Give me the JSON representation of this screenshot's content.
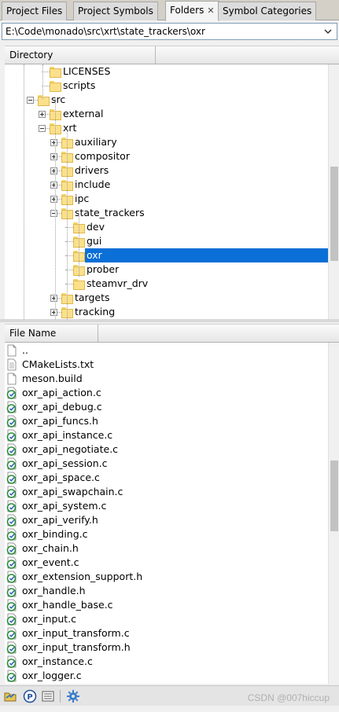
{
  "tabs": [
    {
      "label": "Project Files",
      "active": false
    },
    {
      "label": "Project Symbols",
      "active": false
    },
    {
      "label": "Folders",
      "active": true
    },
    {
      "label": "Symbol Categories",
      "active": false
    }
  ],
  "path": {
    "value": "E:\\Code\\monado\\src\\xrt\\state_trackers\\oxr"
  },
  "directory": {
    "header": "Directory",
    "items": [
      {
        "label": "LICENSES",
        "level": 3,
        "expander": "none"
      },
      {
        "label": "scripts",
        "level": 3,
        "expander": "none"
      },
      {
        "label": "src",
        "level": 2,
        "expander": "minus",
        "no_folder_expander": true
      },
      {
        "label": "external",
        "level": 3,
        "expander": "plus"
      },
      {
        "label": "xrt",
        "level": 3,
        "expander": "minus"
      },
      {
        "label": "auxiliary",
        "level": 4,
        "expander": "plus"
      },
      {
        "label": "compositor",
        "level": 4,
        "expander": "plus"
      },
      {
        "label": "drivers",
        "level": 4,
        "expander": "plus"
      },
      {
        "label": "include",
        "level": 4,
        "expander": "plus"
      },
      {
        "label": "ipc",
        "level": 4,
        "expander": "plus"
      },
      {
        "label": "state_trackers",
        "level": 4,
        "expander": "minus"
      },
      {
        "label": "dev",
        "level": 5,
        "expander": "none"
      },
      {
        "label": "gui",
        "level": 5,
        "expander": "none"
      },
      {
        "label": "oxr",
        "level": 5,
        "expander": "none",
        "selected": true
      },
      {
        "label": "prober",
        "level": 5,
        "expander": "none"
      },
      {
        "label": "steamvr_drv",
        "level": 5,
        "expander": "none"
      },
      {
        "label": "targets",
        "level": 4,
        "expander": "plus"
      },
      {
        "label": "tracking",
        "level": 4,
        "expander": "plus"
      }
    ],
    "scroll_position": 0.55
  },
  "files": {
    "header": "File Name",
    "items": [
      {
        "name": "..",
        "icon": "blank-file-icon"
      },
      {
        "name": "CMakeLists.txt",
        "icon": "text-file-icon"
      },
      {
        "name": "meson.build",
        "icon": "blank-file-icon"
      },
      {
        "name": "oxr_api_action.c",
        "icon": "c-source-icon"
      },
      {
        "name": "oxr_api_debug.c",
        "icon": "c-source-icon"
      },
      {
        "name": "oxr_api_funcs.h",
        "icon": "c-source-icon"
      },
      {
        "name": "oxr_api_instance.c",
        "icon": "c-source-icon"
      },
      {
        "name": "oxr_api_negotiate.c",
        "icon": "c-source-icon"
      },
      {
        "name": "oxr_api_session.c",
        "icon": "c-source-icon"
      },
      {
        "name": "oxr_api_space.c",
        "icon": "c-source-icon"
      },
      {
        "name": "oxr_api_swapchain.c",
        "icon": "c-source-icon"
      },
      {
        "name": "oxr_api_system.c",
        "icon": "c-source-icon"
      },
      {
        "name": "oxr_api_verify.h",
        "icon": "c-source-icon"
      },
      {
        "name": "oxr_binding.c",
        "icon": "c-source-icon"
      },
      {
        "name": "oxr_chain.h",
        "icon": "c-source-icon"
      },
      {
        "name": "oxr_event.c",
        "icon": "c-source-icon"
      },
      {
        "name": "oxr_extension_support.h",
        "icon": "c-source-icon"
      },
      {
        "name": "oxr_handle.h",
        "icon": "c-source-icon"
      },
      {
        "name": "oxr_handle_base.c",
        "icon": "c-source-icon"
      },
      {
        "name": "oxr_input.c",
        "icon": "c-source-icon"
      },
      {
        "name": "oxr_input_transform.c",
        "icon": "c-source-icon"
      },
      {
        "name": "oxr_input_transform.h",
        "icon": "c-source-icon"
      },
      {
        "name": "oxr_instance.c",
        "icon": "c-source-icon"
      },
      {
        "name": "oxr_logger.c",
        "icon": "c-source-icon"
      }
    ],
    "scroll_position": 0.45
  },
  "toolbar": {
    "buttons": [
      "open-folder-icon",
      "project-icon",
      "list-view-icon",
      "settings-gear-icon"
    ],
    "watermark": "CSDN @007hiccup"
  },
  "colors": {
    "selection": "#0a6fd6",
    "folder": "#fbe08a"
  }
}
